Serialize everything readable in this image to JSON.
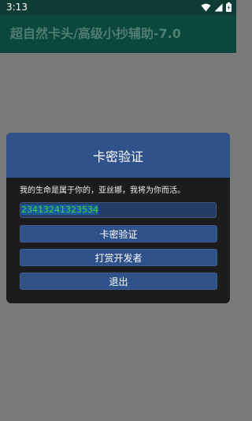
{
  "status_bar": {
    "time": "3:13",
    "icons": [
      "wifi-icon",
      "signal-icon",
      "battery-charging-icon"
    ]
  },
  "app_bar": {
    "title": "超自然卡头/高级小抄辅助-7.0"
  },
  "dialog": {
    "title": "卡密验证",
    "message": "我的生命是属于你的，亚丝娜，我将为你而活。",
    "code_value": "23413241323534",
    "buttons": {
      "verify": "卡密验证",
      "donate": "打赏开发者",
      "exit": "退出"
    }
  },
  "colors": {
    "status_bar": "#0e3b33",
    "app_bar": "#0b473d",
    "dialog_accent": "#2f528a",
    "dialog_bg": "#1c1c1c",
    "input_text": "#3ddc3a"
  }
}
